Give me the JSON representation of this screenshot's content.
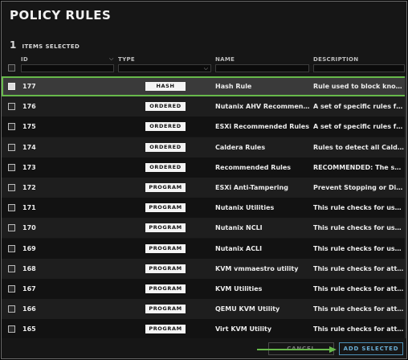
{
  "dialog": {
    "title": "POLICY RULES",
    "selected_count": "1",
    "selected_label": "ITEMS SELECTED"
  },
  "columns": {
    "id": "ID",
    "type": "TYPE",
    "name": "NAME",
    "description": "DESCRIPTION"
  },
  "rows": [
    {
      "id": "177",
      "type": "HASH",
      "name": "Hash Rule",
      "description": "Rule used to block known malicious hashes",
      "selected": true
    },
    {
      "id": "176",
      "type": "ORDERED",
      "name": "Nutanix AHV Recommended Rules",
      "description": "A set of specific rules for protecting Nutanix AHV"
    },
    {
      "id": "175",
      "type": "ORDERED",
      "name": "ESXi Recommended Rules",
      "description": "A set of specific rules for protecting ESXi"
    },
    {
      "id": "174",
      "type": "ORDERED",
      "name": "Caldera Rules",
      "description": "Rules to detect all Caldera Linux abilities"
    },
    {
      "id": "173",
      "type": "ORDERED",
      "name": "Recommended Rules",
      "description": "RECOMMENDED: The set of rules"
    },
    {
      "id": "172",
      "type": "PROGRAM",
      "name": "ESXi Anti-Tampering",
      "description": "Prevent Stopping or Disabling the agent"
    },
    {
      "id": "171",
      "type": "PROGRAM",
      "name": "Nutanix Utilities",
      "description": "This rule checks for usage of utilities"
    },
    {
      "id": "170",
      "type": "PROGRAM",
      "name": "Nutanix NCLI",
      "description": "This rule checks for usage of NCLI"
    },
    {
      "id": "169",
      "type": "PROGRAM",
      "name": "Nutanix ACLI",
      "description": "This rule checks for usage of ACLI"
    },
    {
      "id": "168",
      "type": "PROGRAM",
      "name": "KVM vmmaestro utility",
      "description": "This rule checks for attempts to run vmmaestro"
    },
    {
      "id": "167",
      "type": "PROGRAM",
      "name": "KVM Utilities",
      "description": "This rule checks for attempts to run utilities"
    },
    {
      "id": "166",
      "type": "PROGRAM",
      "name": "QEMU KVM Utility",
      "description": "This rule checks for attempts to run qemu"
    },
    {
      "id": "165",
      "type": "PROGRAM",
      "name": "Virt KVM Utility",
      "description": "This rule checks for attempts to run virt"
    }
  ],
  "footer": {
    "cancel_label": "CANCEL",
    "add_label": "ADD SELECTED"
  },
  "colors": {
    "highlight": "#67b94b",
    "primary_button": "#6aaed6",
    "badge_bg": "#f4f4f4"
  }
}
